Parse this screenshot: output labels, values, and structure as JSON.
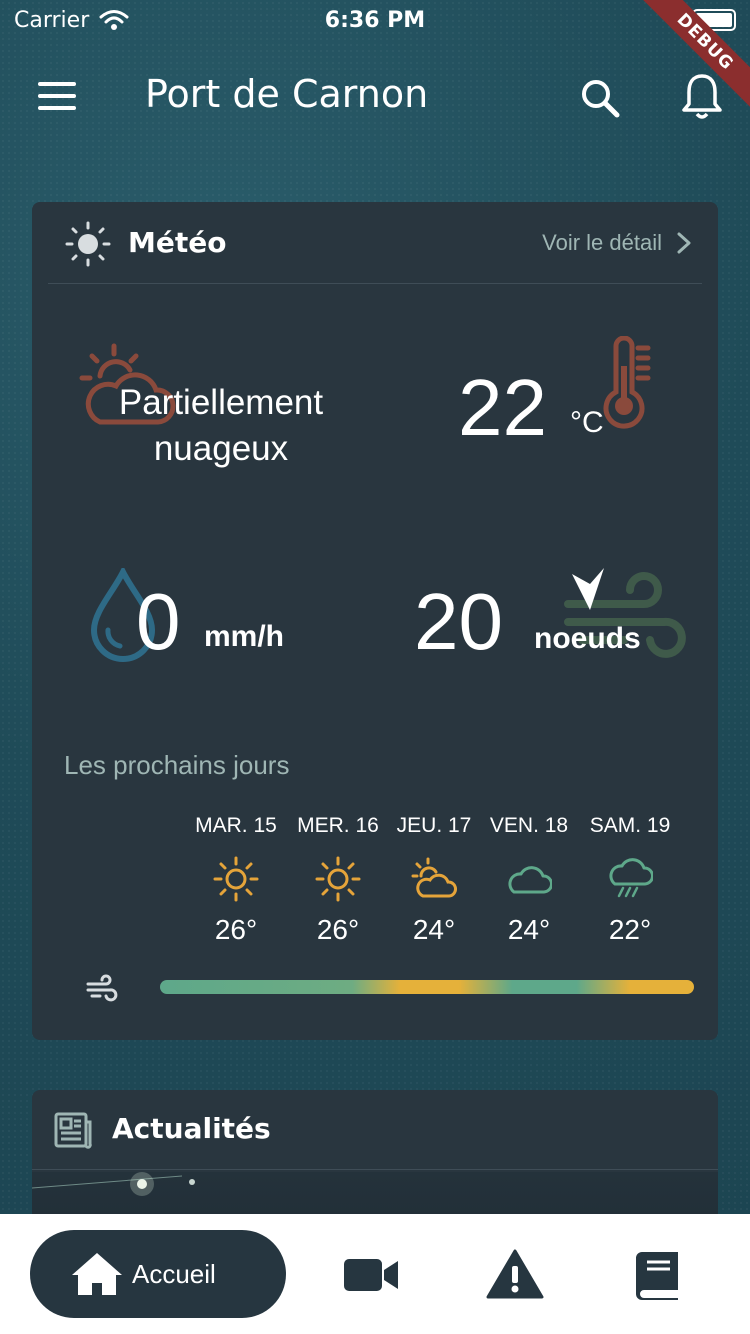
{
  "status_bar": {
    "carrier": "Carrier",
    "time": "6:36 PM"
  },
  "debug_ribbon": "DEBUG",
  "header": {
    "title": "Port de Carnon"
  },
  "weather": {
    "title": "Météo",
    "detail_link": "Voir le détail",
    "condition": "Partiellement nuageux",
    "temperature": "22",
    "temperature_unit": "°C",
    "rain": "0",
    "rain_unit": "mm/h",
    "wind": "20",
    "wind_unit": "noeuds",
    "next_days_title": "Les prochains jours",
    "forecast": [
      {
        "day": "MAR. 15",
        "icon": "sun-icon",
        "temp": "26°"
      },
      {
        "day": "MER. 16",
        "icon": "sun-icon",
        "temp": "26°"
      },
      {
        "day": "JEU. 17",
        "icon": "partly-cloudy-icon",
        "temp": "24°"
      },
      {
        "day": "VEN. 18",
        "icon": "cloud-icon",
        "temp": "24°"
      },
      {
        "day": "SAM. 19",
        "icon": "rain-cloud-icon",
        "temp": "22°"
      }
    ]
  },
  "news": {
    "title": "Actualités"
  },
  "bottom_nav": {
    "home_label": "Accueil"
  },
  "colors": {
    "card_bg": "#29363f",
    "accent_orange": "#e5a43a",
    "accent_green": "#5ea88a",
    "muted_text": "#9fb6b4"
  }
}
